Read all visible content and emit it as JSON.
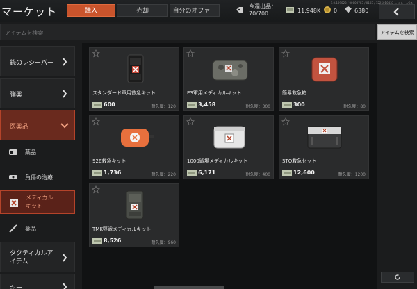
{
  "header": {
    "title": "マーケット",
    "tabs": [
      {
        "label": "購入"
      },
      {
        "label": "売却"
      },
      {
        "label": "自分のオファー"
      }
    ],
    "sales_label": "今週出品：",
    "sales_value": "70/700",
    "currency": [
      {
        "icon": "money-icon",
        "value": "11,948K"
      },
      {
        "icon": "coin-icon",
        "value": "0"
      },
      {
        "icon": "gem-icon",
        "value": "6380"
      }
    ],
    "version_text": "1.0.109023 / 00000703 / 0103 / 1225010433 ... ミレー/パス"
  },
  "search": {
    "placeholder": "アイテムを検索",
    "button_label": "アイテムを検索"
  },
  "sidebar": {
    "categories": [
      {
        "label": "銃のレシーバー"
      },
      {
        "label": "弾薬"
      },
      {
        "label": "医薬品"
      }
    ],
    "subcategories": [
      {
        "label": "薬品",
        "icon": "pills-icon"
      },
      {
        "label": "負傷の治療",
        "icon": "bandage-icon"
      },
      {
        "label": "メディカル\nキット",
        "icon": "medkit-icon"
      },
      {
        "label": "薬品",
        "icon": "syringe-icon"
      }
    ],
    "more_categories": [
      {
        "label": "タクティカルア\nイテム"
      },
      {
        "label": "キー"
      }
    ]
  },
  "items": [
    {
      "name": "スタンダード軍用救急キット",
      "price": "600",
      "durability": "耐久度：120"
    },
    {
      "name": "E3軍用メディカルキット",
      "price": "3,458",
      "durability": "耐久度：300"
    },
    {
      "name": "簡易救急箱",
      "price": "300",
      "durability": "耐久度：80"
    },
    {
      "name": "926救急キット",
      "price": "1,736",
      "durability": "耐久度：220"
    },
    {
      "name": "1000戦場メディカルキット",
      "price": "6,171",
      "durability": "耐久度：400"
    },
    {
      "name": "STO救急セット",
      "price": "12,600",
      "durability": "耐久度：1200"
    },
    {
      "name": "TMK野戦メディカルキット",
      "price": "8,526",
      "durability": "耐久度：960"
    }
  ],
  "colors": {
    "accent": "#c9542c",
    "selected_bg": "#6a2a1e"
  }
}
